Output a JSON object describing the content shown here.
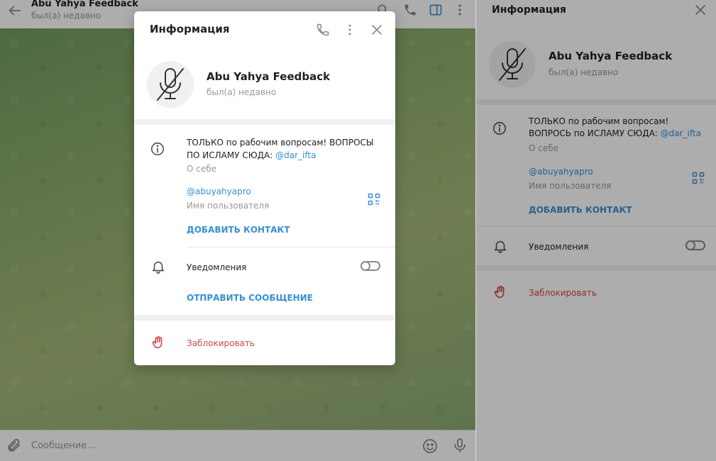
{
  "chat": {
    "title": "Abu Yahya Feedback",
    "status": "был(а) недавно",
    "composer_placeholder": "Сообщение..."
  },
  "panel": {
    "title": "Информация",
    "name": "Abu Yahya Feedback",
    "status": "был(а) недавно",
    "about_text": "ТОЛЬКО по рабочим вопросам! ВОПРОСЬ по ИСЛАМУ СЮДА: ",
    "about_link": "@dar_ifta",
    "about_label": "О себе",
    "username": "@abuyahyapro",
    "username_label": "Имя пользователя",
    "add_contact": "ДОБАВИТЬ КОНТАКТ",
    "notifications": "Уведомления",
    "block": "Заблокировать"
  },
  "modal": {
    "title": "Информация",
    "name": "Abu Yahya Feedback",
    "status": "был(а) недавно",
    "about_text": "ТОЛЬКО по рабочим вопросам! ВОПРОСЫ ПО ИСЛАМУ СЮДА: ",
    "about_link": "@dar_ifta",
    "about_label": "О себе",
    "username": "@abuyahyapro",
    "username_label": "Имя пользователя",
    "add_contact": "ДОБАВИТЬ КОНТАКТ",
    "notifications": "Уведомления",
    "send_message": "ОТПРАВИТЬ СООБЩЕНИЕ",
    "block": "Заблокировать"
  },
  "colors": {
    "accent": "#3a8fd1",
    "danger": "#d14848",
    "muted": "#999999"
  },
  "icons": [
    "back-arrow-icon",
    "search-icon",
    "phone-icon",
    "sidebar-toggle-icon",
    "more-vertical-icon",
    "close-icon",
    "muted-microphone-icon",
    "info-icon",
    "qr-code-icon",
    "bell-icon",
    "hand-stop-icon",
    "paperclip-icon",
    "emoji-icon",
    "microphone-icon"
  ]
}
